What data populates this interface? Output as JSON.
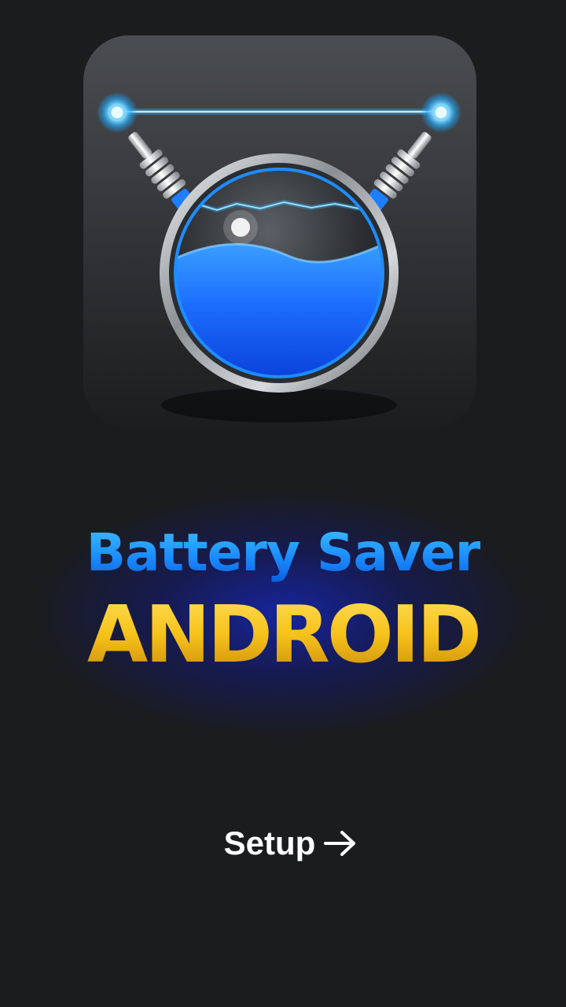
{
  "app": {
    "title_line1": "Battery Saver",
    "title_line2": "ANDROID"
  },
  "setup": {
    "label": "Setup",
    "icon": "arrow-right-icon"
  },
  "logo": {
    "icon": "battery-orb-logo-icon",
    "liquid_color": "#1e6bff",
    "glow_color": "#2fb8ff"
  },
  "colors": {
    "background": "#1b1c1e",
    "title_blue": "#1d8fff",
    "title_gold": "#f6c21a",
    "text_white": "#ffffff"
  }
}
